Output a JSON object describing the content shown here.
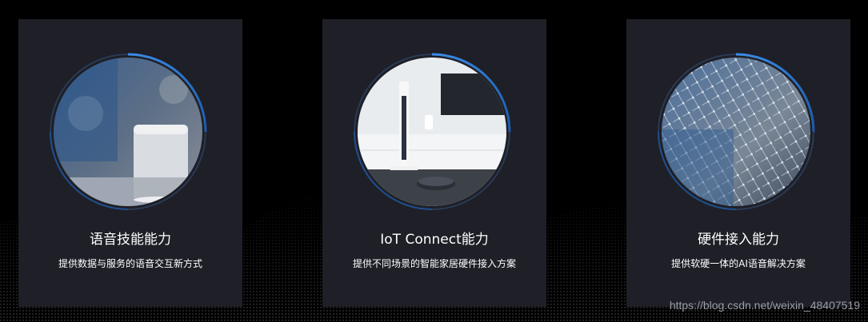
{
  "colors": {
    "background": "#000000",
    "card": "#1e1f27",
    "ring_accent": "#2f7bd6",
    "text": "#ffffff",
    "watermark": "#9a9ea6"
  },
  "cards": [
    {
      "title": "语音技能能力",
      "description": "提供数据与服务的语音交互新方式",
      "image": "smart-speaker-photo"
    },
    {
      "title": "IoT Connect能力",
      "description": "提供不同场景的智能家居硬件接入方案",
      "image": "smart-home-livingroom-photo"
    },
    {
      "title": "硬件接入能力",
      "description": "提供软硬一体的AI语音解决方案",
      "image": "circuit-board-photo"
    }
  ],
  "watermark": "https://blog.csdn.net/weixin_48407519"
}
